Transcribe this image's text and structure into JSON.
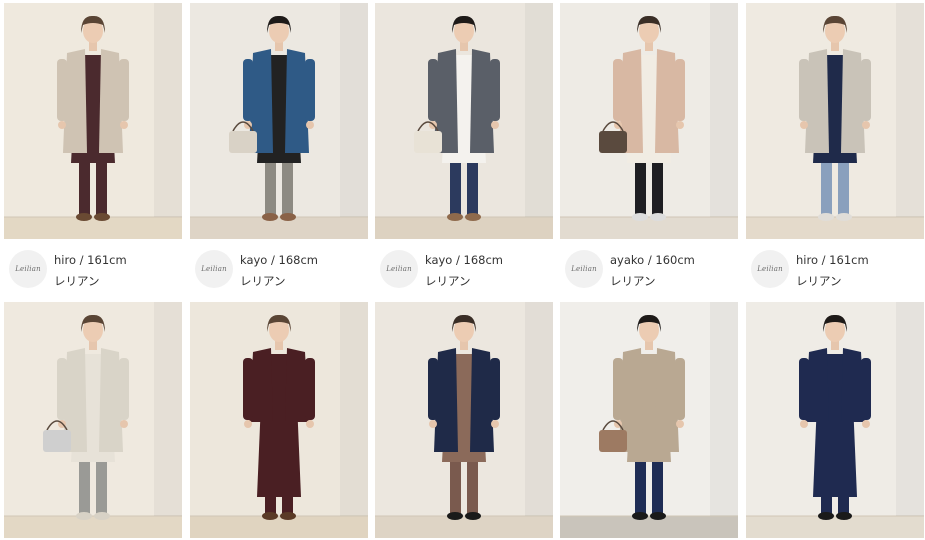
{
  "shop_logo_text": "Leilian",
  "grid_row1": [
    {
      "staff": "hiro / 161cm",
      "shop": "レリアン",
      "bg": "#efe9de",
      "floor": "#e3d8c4",
      "coat": "#cfc3b3",
      "inner": "#4b2a2e",
      "legs": "#4b2a2e",
      "shoes": "#6a4a33",
      "hair": "#5a4535"
    },
    {
      "staff": "kayo / 168cm",
      "shop": "レリアン",
      "bg": "#ece8e1",
      "floor": "#ded4c6",
      "coat": "#2f5a86",
      "inner": "#222222",
      "legs": "#8d8a82",
      "shoes": "#8a6247",
      "hair": "#1e1a18",
      "bag": "#d9d2c6"
    },
    {
      "staff": "kayo / 168cm",
      "shop": "レリアン",
      "bg": "#ebe6de",
      "floor": "#ddd2c1",
      "coat": "#5a5f68",
      "inner": "#f4f2ee",
      "legs": "#2c3a5e",
      "shoes": "#8f6a4c",
      "hair": "#1e1a18",
      "bag": "#e8e2d6"
    },
    {
      "staff": "ayako / 160cm",
      "shop": "レリアン",
      "bg": "#eeebe5",
      "floor": "#e2dbd0",
      "coat": "#d8b8a3",
      "inner": "#f1ece3",
      "legs": "#1e1e22",
      "shoes": "#dddddd",
      "hair": "#3a2e26",
      "bag": "#5a4a3e"
    },
    {
      "staff": "hiro / 161cm",
      "shop": "レリアン",
      "bg": "#efeae1",
      "floor": "#e4dacb",
      "coat": "#c9c3b8",
      "inner": "#1f2a4a",
      "legs": "#8aa0bd",
      "shoes": "#e0ddd8",
      "hair": "#5a4535"
    }
  ],
  "grid_row2": [
    {
      "bg": "#efe9df",
      "floor": "#e3d8c5",
      "coat": "#d9d4c8",
      "inner": "#e7e2d8",
      "legs": "#9a9a96",
      "shoes": "#d8d2c6",
      "hair": "#5a4535",
      "bag": "#cfcfcf"
    },
    {
      "bg": "#ede7dc",
      "floor": "#e0d4c0",
      "coat": "#4a1f23",
      "inner": "#4a1f23",
      "legs": "#4a1f23",
      "shoes": "#5a3a26",
      "hair": "#5a4535"
    },
    {
      "bg": "#ece7df",
      "floor": "#ded4c5",
      "coat": "#1f2a48",
      "inner": "#8b6a5a",
      "legs": "#7a5a4e",
      "shoes": "#1a1a1a",
      "hair": "#3a2e26"
    },
    {
      "bg": "#f0eeea",
      "floor": "#c9c4bb",
      "coat": "#b9a892",
      "inner": "#b9a892",
      "legs": "#1f2d55",
      "shoes": "#1a1a1a",
      "hair": "#1e1a18",
      "bag": "#9d7a62"
    },
    {
      "bg": "#efece6",
      "floor": "#e3dccf",
      "coat": "#1f2a50",
      "inner": "#1f2a50",
      "legs": "#1f2a50",
      "shoes": "#1a1a1a",
      "hair": "#1e1a18"
    }
  ]
}
